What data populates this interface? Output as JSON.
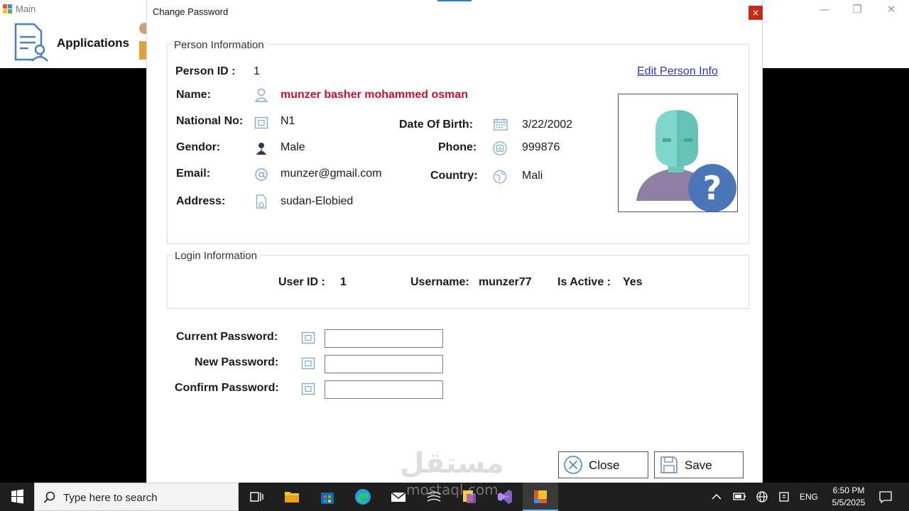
{
  "main_window": {
    "title": "Main",
    "toolbar": {
      "applications_label": "Applications"
    },
    "controls": {
      "minimize": "—",
      "restore": "❐",
      "close": "✕"
    }
  },
  "dialog": {
    "title": "Change Password",
    "close_glyph": "×",
    "person_info": {
      "legend": "Person Information",
      "edit_link": "Edit Person Info",
      "person_id_label": "Person ID :",
      "person_id_value": "1",
      "name_label": "Name:",
      "name_value": "munzer basher mohammed osman",
      "national_no_label": "National No:",
      "national_no_value": "N1",
      "date_of_birth_label": "Date Of Birth:",
      "date_of_birth_value": "3/22/2002",
      "gender_label": "Gendor:",
      "gender_value": "Male",
      "phone_label": "Phone:",
      "phone_value": "999876",
      "email_label": "Email:",
      "email_value": "munzer@gmail.com",
      "country_label": "Country:",
      "country_value": "Mali",
      "address_label": "Address:",
      "address_value": "sudan-Elobied"
    },
    "login_info": {
      "legend": "Login Information",
      "user_id_label": "User ID :",
      "user_id_value": "1",
      "username_label": "Username:",
      "username_value": "munzer77",
      "is_active_label": "Is Active :",
      "is_active_value": "Yes"
    },
    "password": {
      "current_label": "Current Password:",
      "current_value": "",
      "new_label": "New Password:",
      "new_value": "",
      "confirm_label": "Confirm Password:",
      "confirm_value": ""
    },
    "buttons": {
      "close": "Close",
      "save": "Save"
    },
    "watermark": {
      "arabic": "مستقل",
      "latin": "mostaql.com"
    }
  },
  "taskbar": {
    "search_placeholder": "Type here to search",
    "language": "ENG",
    "time": "6:50 PM",
    "date": "5/5/2025"
  },
  "colors": {
    "name_highlight": "#c8102e",
    "link": "#2a35c8",
    "close_button": "#c42b1c",
    "icon_blue": "#7fa9d6"
  }
}
